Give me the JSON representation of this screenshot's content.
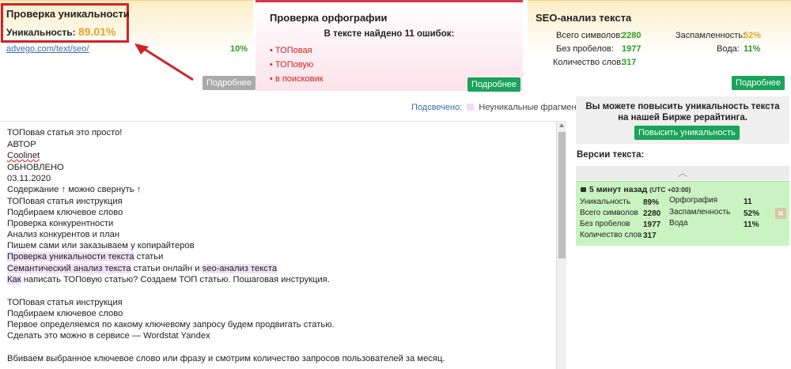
{
  "uniq": {
    "title": "Проверка уникальности",
    "label": "Уникальность:",
    "value": "89.01%",
    "link": "advego.com/text/seo/",
    "percent": "10%",
    "more": "Подробнее"
  },
  "orth": {
    "title": "Проверка орфографии",
    "found": "В тексте найдено 11 ошибок:",
    "errors": [
      "ТОПовая",
      "ТОПовую",
      "в поисковик"
    ],
    "more": "Подробнее"
  },
  "seo": {
    "title": "SEO-анализ текста",
    "total_label": "Всего символов:",
    "total": "2280",
    "nospace_label": "Без пробелов:",
    "nospace": "1977",
    "words_label": "Количество слов:",
    "words": "317",
    "spam_label": "Заспамленность:",
    "spam": "52%",
    "water_label": "Вода:",
    "water": "11%",
    "more": "Подробнее"
  },
  "legend": {
    "label": "Подсвечено:",
    "text": "Неуникальные фрагменты"
  },
  "text": {
    "l1": "ТОПовая статья это просто!",
    "l2": "АВТОР",
    "l3": "Coolinet",
    "l4": "ОБНОВЛЕНО",
    "l5": "03.11.2020",
    "l6": "Содержание ↑ можно свернуть ↑",
    "l7": "ТОПовая статья инструкция",
    "l8": "Подбираем ключевое слово",
    "l9": "Проверка конкурентности",
    "l10": "Анализ конкурентов и план",
    "l11": "Пишем сами или заказываем у копирайтеров",
    "l12a": "Проверка уникальности текста",
    "l12b": " статьи",
    "l13a": "Семантический анализ текста",
    "l13b": " статьи онлайн и ",
    "l13c": "seo-анализ текста",
    "l14a": "Как",
    "l14b": " написать ТОПовую статью? Создаем ТОП статью. Пошаговая инструкция.",
    "l15": "ТОПовая статья инструкция",
    "l16": "Подбираем ключевое слово",
    "l17": "Первое определяемся по какому ключевому запросу будем продвигать статью.",
    "l18": "Сделать это можно в сервисе — Wordstat Yandex",
    "l19": "Вбиваем выбранное ключевое слово или фразу и смотрим количество запросов пользователей за месяц."
  },
  "side": {
    "promo": "Вы можете повысить уникальность текста на нашей Бирже рерайтинга.",
    "promo_btn": "Повысить уникальность",
    "versions_title": "Версии текста:",
    "time": "5 минут назад",
    "tz": "(UTC +03:00)",
    "uniq_label": "Уникальность",
    "uniq": "89%",
    "orth_label": "Орфография",
    "orth": "11",
    "total_label": "Всего символов",
    "total": "2280",
    "spam_label": "Заспамленность",
    "spam": "52%",
    "nospace_label": "Без пробелов",
    "nospace": "1977",
    "water_label": "Вода",
    "water": "11%",
    "words_label": "Количество слов",
    "words": "317",
    "close": "×"
  }
}
